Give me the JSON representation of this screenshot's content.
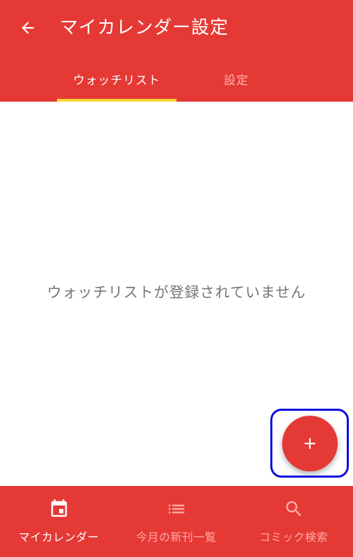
{
  "app_bar": {
    "title": "マイカレンダー設定",
    "back_icon": "arrow-back-icon",
    "background_color": "#e53935"
  },
  "tabs": [
    {
      "label": "ウォッチリスト",
      "selected": true
    },
    {
      "label": "設定",
      "selected": false
    }
  ],
  "tab_indicator_color": "#fdd835",
  "main": {
    "empty_message": "ウォッチリストが登録されていません"
  },
  "fab": {
    "icon": "plus-icon",
    "highlight_color": "#0a0ae0"
  },
  "bottom_nav": {
    "items": [
      {
        "label": "マイカレンダー",
        "icon": "calendar-icon",
        "active": true
      },
      {
        "label": "今月の新刊一覧",
        "icon": "list-icon",
        "active": false
      },
      {
        "label": "コミック検索",
        "icon": "search-icon",
        "active": false
      }
    ]
  }
}
